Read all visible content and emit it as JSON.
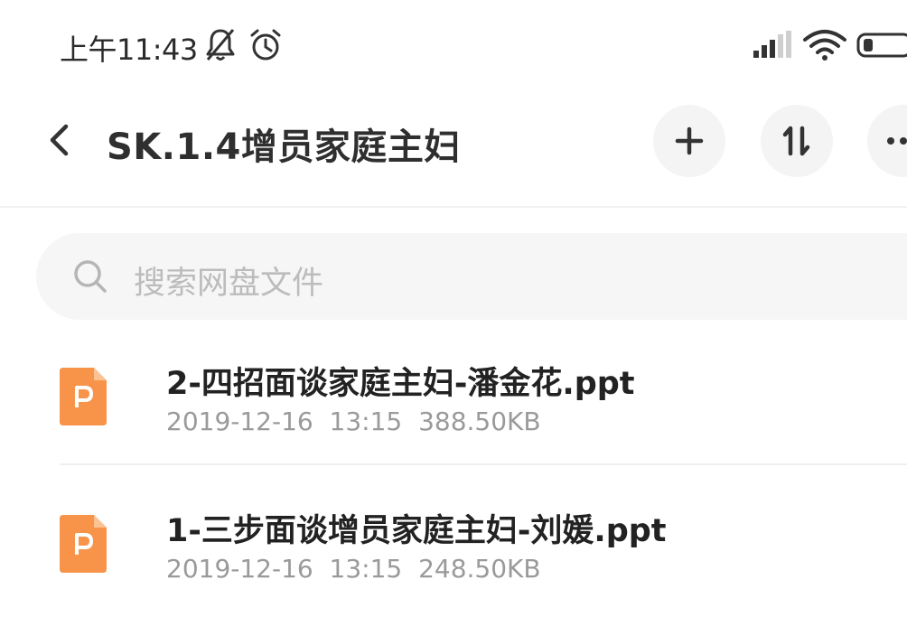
{
  "status_bar": {
    "time": "上午11:43",
    "icons": [
      "bell-off-icon",
      "alarm-clock-icon",
      "signal-icon",
      "wifi-icon",
      "battery-icon"
    ]
  },
  "header": {
    "back_icon": "chevron-left-icon",
    "title": "SK.1.4增员家庭主妇",
    "actions": [
      "plus-icon",
      "sort-icon",
      "more-icon"
    ]
  },
  "search": {
    "icon": "search-icon",
    "placeholder": "搜索网盘文件"
  },
  "files": [
    {
      "icon": "ppt-file-icon",
      "name": "2-四招面谈家庭主妇-潘金花.ppt",
      "date": "2019-12-16",
      "time": "13:15",
      "size": "388.50KB"
    },
    {
      "icon": "ppt-file-icon",
      "name": "1-三步面谈增员家庭主妇-刘媛.ppt",
      "date": "2019-12-16",
      "time": "13:15",
      "size": "248.50KB"
    }
  ],
  "colors": {
    "ppt_icon": "#F7944A",
    "meta_text": "#9A9A9A",
    "search_bg": "#F6F6F6"
  }
}
